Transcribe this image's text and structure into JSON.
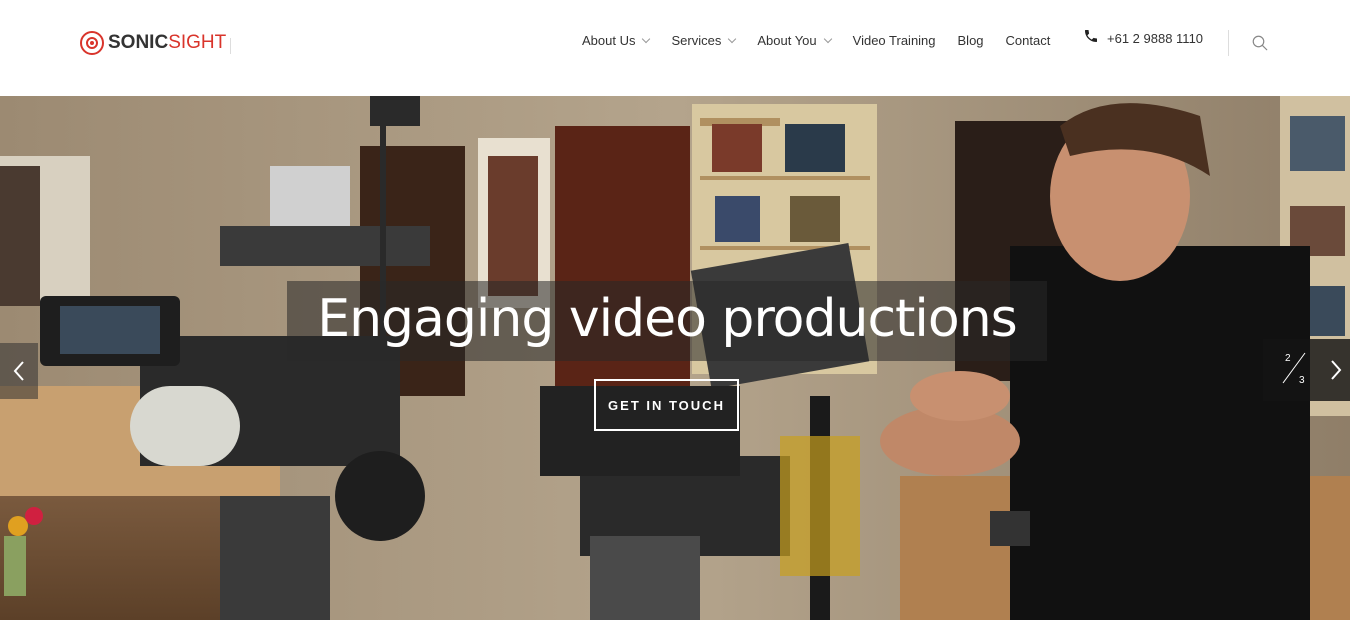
{
  "brand": {
    "name_part1": "SONIC",
    "name_part2": "SIGHT",
    "accent_color": "#d9342b"
  },
  "nav": {
    "items": [
      {
        "label": "About Us",
        "has_dropdown": true
      },
      {
        "label": "Services",
        "has_dropdown": true
      },
      {
        "label": "About You",
        "has_dropdown": true
      },
      {
        "label": "Video Training",
        "has_dropdown": false
      },
      {
        "label": "Blog",
        "has_dropdown": false
      },
      {
        "label": "Contact",
        "has_dropdown": false
      }
    ]
  },
  "contact": {
    "phone": "+61 2 9888 1110",
    "icon": "phone-icon"
  },
  "search": {
    "icon": "search-icon"
  },
  "hero": {
    "caption": "Engaging video productions",
    "cta_label": "GET IN TOUCH",
    "slide_current": "2",
    "slide_total": "3",
    "prev_icon": "chevron-left-icon",
    "next_icon": "chevron-right-icon"
  }
}
